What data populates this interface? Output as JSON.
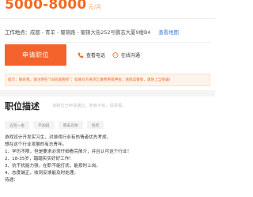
{
  "header": {
    "salary": "5000-8000",
    "salary_unit": "元/月"
  },
  "location": {
    "label": "工作地点：",
    "address": "成都 - 青羊 - 蜀锦路 - 蜀锦大街252号鹏志大厦9楼B4",
    "map_link": "查看地图"
  },
  "actions": {
    "apply_label": "申请职位",
    "phone_label": "查看电话",
    "chat_label": "在线沟通"
  },
  "colors": {
    "accent": "#f26b21",
    "link": "#3a7fd5",
    "chat": "#f26b21"
  },
  "tip": {
    "text": "提示：联系我，请注明在“58同城看到”；如果对方要求汇缴费用或押金，请提高警惕，谨防上当受骗！"
  },
  "description": {
    "title": "职位描述",
    "note": "该职位已申请通过，若有不实，请举报。",
    "tags": [
      "五险一金",
      "不加班",
      "周末双休",
      "包吃"
    ],
    "lines": [
      "游戏设计开发实习生，对游戏行业有热情者优先考虑，",
      "想在这个行业发展的有志青年。",
      "1、学历不限，但是要求必须仔细看完简介，并且认可这个行业！",
      "2、18-35岁，踏踏实实好好工作！",
      "3、抗干扰能力强，在职不能打扰，能按时上岗。",
      "4、态度端正，收到反馈能及时处理。",
      "待遇："
    ]
  }
}
